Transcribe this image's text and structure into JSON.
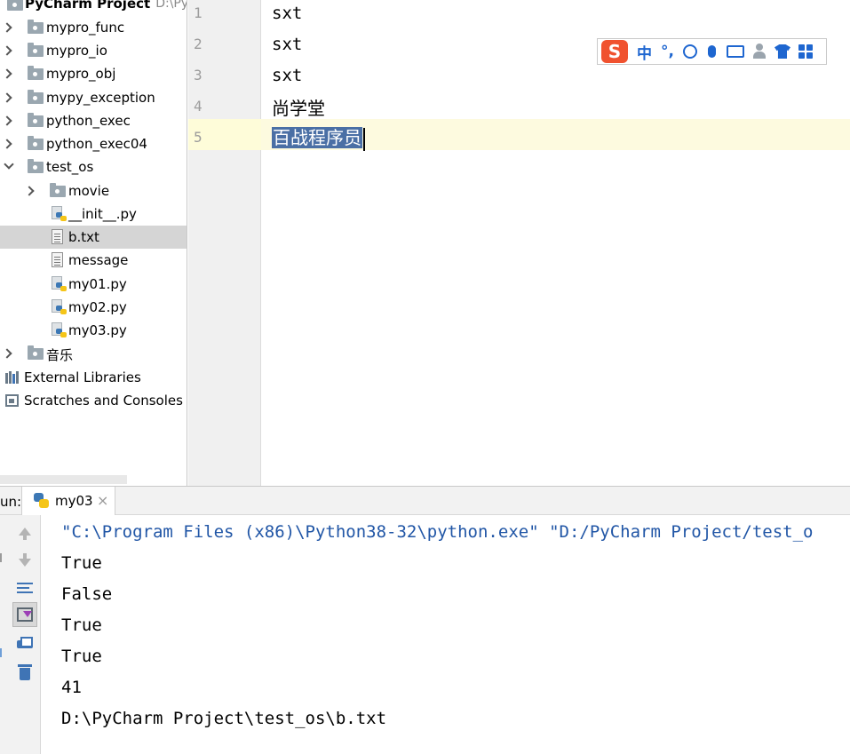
{
  "project": {
    "root_name": "PyCharm Project",
    "root_path": "D:\\PyCh",
    "items": [
      {
        "label": "mypro_func",
        "type": "folder",
        "expanded": false
      },
      {
        "label": "mypro_io",
        "type": "folder",
        "expanded": false
      },
      {
        "label": "mypro_obj",
        "type": "folder",
        "expanded": false
      },
      {
        "label": "mypy_exception",
        "type": "folder",
        "expanded": false
      },
      {
        "label": "python_exec",
        "type": "folder",
        "expanded": false
      },
      {
        "label": "python_exec04",
        "type": "folder",
        "expanded": false
      },
      {
        "label": "test_os",
        "type": "folder",
        "expanded": true
      },
      {
        "label": "movie",
        "type": "folder",
        "expanded": false
      },
      {
        "label": "__init__.py",
        "type": "python"
      },
      {
        "label": "b.txt",
        "type": "text",
        "selected": true
      },
      {
        "label": "message",
        "type": "text"
      },
      {
        "label": "my01.py",
        "type": "python"
      },
      {
        "label": "my02.py",
        "type": "python"
      },
      {
        "label": "my03.py",
        "type": "python"
      },
      {
        "label": "音乐",
        "type": "folder",
        "expanded": false
      },
      {
        "label": "External Libraries",
        "type": "library"
      },
      {
        "label": "Scratches and Consoles",
        "type": "scratch"
      }
    ]
  },
  "editor": {
    "line_numbers": [
      "1",
      "2",
      "3",
      "4",
      "5"
    ],
    "lines": [
      "sxt",
      "sxt",
      "sxt",
      "尚学堂",
      "百战程序员"
    ],
    "current_line": 5
  },
  "ime": {
    "logo": "S",
    "items": [
      "中",
      "°,"
    ],
    "icons": [
      "smile-icon",
      "mic-icon",
      "keyboard-icon",
      "person-icon",
      "shirt-icon",
      "grid-icon"
    ],
    "accent": "#1e66d0"
  },
  "run": {
    "label": "un:",
    "tab_label": "my03",
    "tab_close": "×",
    "output": [
      "\"C:\\Program Files (x86)\\Python38-32\\python.exe\" \"D:/PyCharm Project/test_o",
      "True",
      "False",
      "True",
      "True",
      "41",
      "D:\\PyCharm Project\\test_os\\b.txt"
    ]
  },
  "colors": {
    "selection": "#4a6fa5",
    "current_line": "#fdfadf",
    "command_text": "#2156a6"
  }
}
